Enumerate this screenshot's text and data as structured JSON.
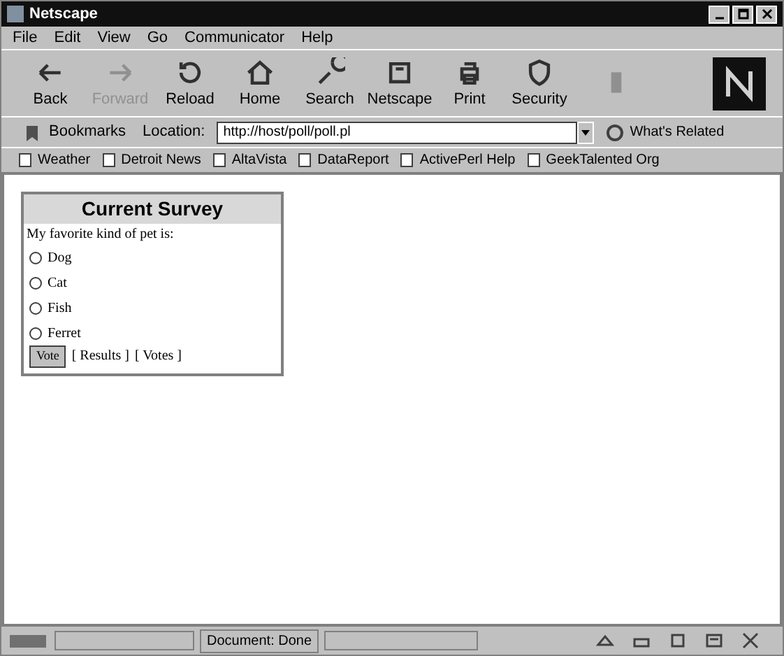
{
  "window": {
    "title": "Netscape"
  },
  "menu": [
    "File",
    "Edit",
    "View",
    "Go",
    "Communicator",
    "Help"
  ],
  "toolbar": [
    {
      "label": "Back",
      "disabled": false
    },
    {
      "label": "Forward",
      "disabled": true
    },
    {
      "label": "Reload",
      "disabled": false
    },
    {
      "label": "Home",
      "disabled": false
    },
    {
      "label": "Search",
      "disabled": false
    },
    {
      "label": "Netscape",
      "disabled": false
    },
    {
      "label": "Print",
      "disabled": false
    },
    {
      "label": "Security",
      "disabled": false
    }
  ],
  "stop_button": {
    "disabled": true
  },
  "location_bar": {
    "bookmarks": "Bookmarks",
    "location_label": "Location:",
    "url": "http://host/poll/poll.pl",
    "related": "What's Related"
  },
  "personal_toolbar": [
    "Weather",
    "Detroit News",
    "AltaVista",
    "DataReport",
    "ActivePerl Help",
    "GeekTalented Org"
  ],
  "survey": {
    "title": "Current Survey",
    "question": "My favorite kind of pet is:",
    "options": [
      {
        "label": "Dog",
        "selected": false
      },
      {
        "label": "Cat",
        "selected": false
      },
      {
        "label": "Fish",
        "selected": false
      },
      {
        "label": "Ferret",
        "selected": false
      }
    ],
    "vote_button": "Vote",
    "links": [
      "[ Results ]",
      "[ Votes ]"
    ]
  },
  "status_bar": {
    "text": "Document: Done"
  }
}
